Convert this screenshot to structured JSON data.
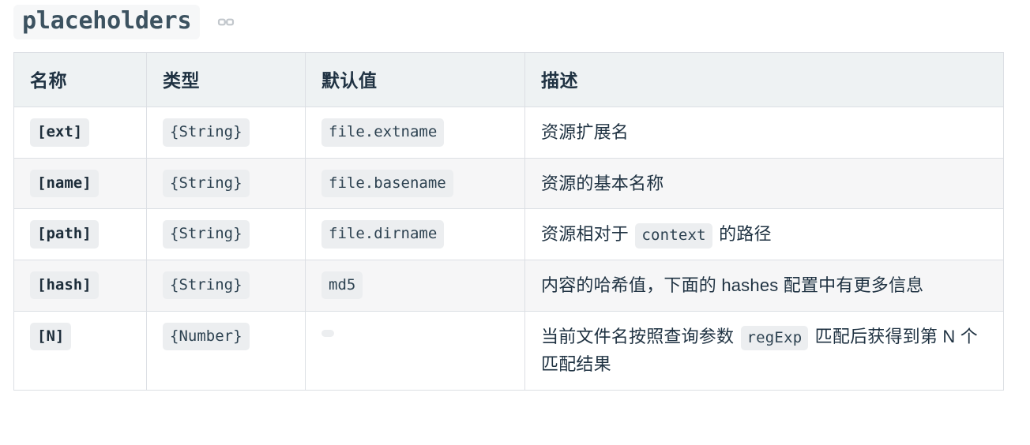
{
  "heading": {
    "title": "placeholders",
    "anchor_icon": "link-chain-icon"
  },
  "table": {
    "columns": [
      {
        "key": "name",
        "label": "名称"
      },
      {
        "key": "type",
        "label": "类型"
      },
      {
        "key": "default",
        "label": "默认值"
      },
      {
        "key": "desc",
        "label": "描述"
      }
    ],
    "rows": [
      {
        "name": "[ext]",
        "type": "{String}",
        "default": "file.extname",
        "desc_parts": [
          {
            "kind": "text",
            "value": "资源扩展名"
          }
        ]
      },
      {
        "name": "[name]",
        "type": "{String}",
        "default": "file.basename",
        "desc_parts": [
          {
            "kind": "text",
            "value": "资源的基本名称"
          }
        ]
      },
      {
        "name": "[path]",
        "type": "{String}",
        "default": "file.dirname",
        "desc_parts": [
          {
            "kind": "text",
            "value": "资源相对于 "
          },
          {
            "kind": "code",
            "value": "context"
          },
          {
            "kind": "text",
            "value": " 的路径"
          }
        ]
      },
      {
        "name": "[hash]",
        "type": "{String}",
        "default": "md5",
        "desc_parts": [
          {
            "kind": "text",
            "value": "内容的哈希值，下面的 hashes 配置中有更多信息"
          }
        ]
      },
      {
        "name": "[N]",
        "type": "{Number}",
        "default": "",
        "desc_parts": [
          {
            "kind": "text",
            "value": "当前文件名按照查询参数 "
          },
          {
            "kind": "code",
            "value": "regExp"
          },
          {
            "kind": "text",
            "value": " 匹配后获得到第 N 个匹配结果"
          }
        ]
      }
    ]
  },
  "colors": {
    "text": "#1f3242",
    "heading": "#3c5260",
    "header_bg": "#eef2f3",
    "zebra_bg": "#f6f6f7",
    "border": "#dcdfe4",
    "code_bg": "#eceef0",
    "anchor_icon": "#c2c7cc"
  }
}
